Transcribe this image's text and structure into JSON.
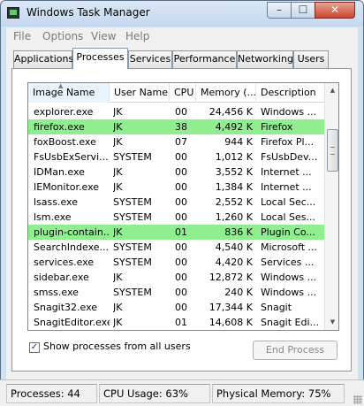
{
  "window": {
    "title": "Windows Task Manager"
  },
  "titlebar_buttons": {
    "minimize": "–",
    "maximize": "☐",
    "close": "✕"
  },
  "menu": [
    "File",
    "Options",
    "View",
    "Help"
  ],
  "tabs": [
    {
      "label": "Applications",
      "active": false
    },
    {
      "label": "Processes",
      "active": true
    },
    {
      "label": "Services",
      "active": false
    },
    {
      "label": "Performance",
      "active": false
    },
    {
      "label": "Networking",
      "active": false
    },
    {
      "label": "Users",
      "active": false
    }
  ],
  "table": {
    "columns": [
      "Image Name",
      "User Name",
      "CPU",
      "Memory (...",
      "Description"
    ],
    "sort_indicator": "▲",
    "rows": [
      {
        "name": "explorer.exe",
        "user": "JK",
        "cpu": "00",
        "mem": "24,456 K",
        "desc": "Windows ...",
        "highlight": false
      },
      {
        "name": "firefox.exe",
        "user": "JK",
        "cpu": "38",
        "mem": "4,492 K",
        "desc": "Firefox",
        "highlight": true
      },
      {
        "name": "foxBoost.exe",
        "user": "JK",
        "cpu": "07",
        "mem": "944 K",
        "desc": "Firefox Pl...",
        "highlight": false
      },
      {
        "name": "FsUsbExServi...",
        "user": "SYSTEM",
        "cpu": "00",
        "mem": "1,012 K",
        "desc": "FsUsbDev...",
        "highlight": false
      },
      {
        "name": "IDMan.exe",
        "user": "JK",
        "cpu": "00",
        "mem": "3,552 K",
        "desc": "Internet ...",
        "highlight": false
      },
      {
        "name": "IEMonitor.exe",
        "user": "JK",
        "cpu": "00",
        "mem": "1,384 K",
        "desc": "Internet ...",
        "highlight": false
      },
      {
        "name": "lsass.exe",
        "user": "SYSTEM",
        "cpu": "00",
        "mem": "2,552 K",
        "desc": "Local Sec...",
        "highlight": false
      },
      {
        "name": "lsm.exe",
        "user": "SYSTEM",
        "cpu": "00",
        "mem": "1,260 K",
        "desc": "Local Ses...",
        "highlight": false
      },
      {
        "name": "plugin-contain...",
        "user": "JK",
        "cpu": "01",
        "mem": "836 K",
        "desc": "Plugin Co...",
        "highlight": true
      },
      {
        "name": "SearchIndexe...",
        "user": "SYSTEM",
        "cpu": "00",
        "mem": "4,540 K",
        "desc": "Microsoft ...",
        "highlight": false
      },
      {
        "name": "services.exe",
        "user": "SYSTEM",
        "cpu": "00",
        "mem": "4,420 K",
        "desc": "Services ...",
        "highlight": false
      },
      {
        "name": "sidebar.exe",
        "user": "JK",
        "cpu": "00",
        "mem": "12,872 K",
        "desc": "Windows ...",
        "highlight": false
      },
      {
        "name": "smss.exe",
        "user": "SYSTEM",
        "cpu": "00",
        "mem": "240 K",
        "desc": "Windows ...",
        "highlight": false
      },
      {
        "name": "Snagit32.exe",
        "user": "JK",
        "cpu": "00",
        "mem": "17,344 K",
        "desc": "Snagit",
        "highlight": false
      },
      {
        "name": "SnagitEditor.exe",
        "user": "JK",
        "cpu": "01",
        "mem": "14,608 K",
        "desc": "Snagit Edi...",
        "highlight": false
      }
    ]
  },
  "scrollbar": {
    "up": "▲",
    "down": "▼"
  },
  "options": {
    "show_all_users_label": "Show processes from all users",
    "show_all_users_checked": true,
    "check_mark": "✓"
  },
  "end_process_label": "End Process",
  "status": {
    "processes": "Processes: 44",
    "cpu": "CPU Usage: 63%",
    "memory": "Physical Memory: 75%"
  },
  "colors": {
    "highlight_row": "#90ee90",
    "titlebar": "#cfe0f1"
  }
}
